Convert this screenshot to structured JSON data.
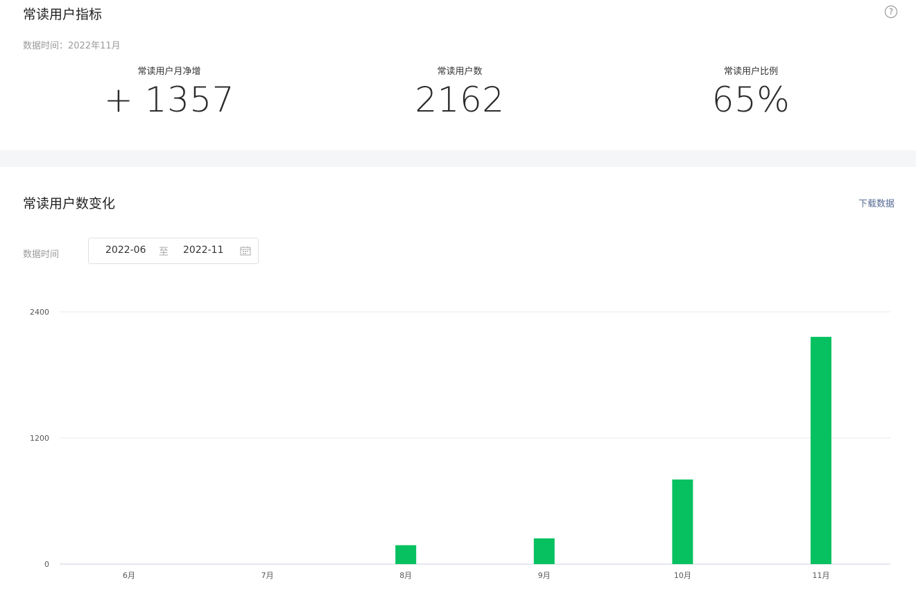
{
  "indicators": {
    "title": "常读用户指标",
    "help_symbol": "?",
    "data_time": "数据时间：2022年11月",
    "metrics": [
      {
        "label": "常读用户月净增",
        "value": "+ 1357"
      },
      {
        "label": "常读用户数",
        "value": "2162"
      },
      {
        "label": "常读用户比例",
        "value": "65%"
      }
    ]
  },
  "trend": {
    "title": "常读用户数变化",
    "download_label": "下载数据",
    "filter_label": "数据时间",
    "date_range": {
      "start": "2022-06",
      "separator": "至",
      "end": "2022-11"
    }
  },
  "colors": {
    "bar": "#07c160",
    "grid": "#e8e8e8",
    "axis": "#c8cfdb",
    "link": "#576b95",
    "separator_band": "#f5f6f7"
  },
  "chart_data": {
    "type": "bar",
    "categories": [
      "6月",
      "7月",
      "8月",
      "9月",
      "10月",
      "11月"
    ],
    "values": [
      0,
      0,
      180,
      245,
      805,
      2162
    ],
    "yticks": [
      0,
      1200,
      2400
    ],
    "ylim": [
      0,
      2400
    ],
    "grid": true,
    "title": "",
    "xlabel": "",
    "ylabel": ""
  }
}
